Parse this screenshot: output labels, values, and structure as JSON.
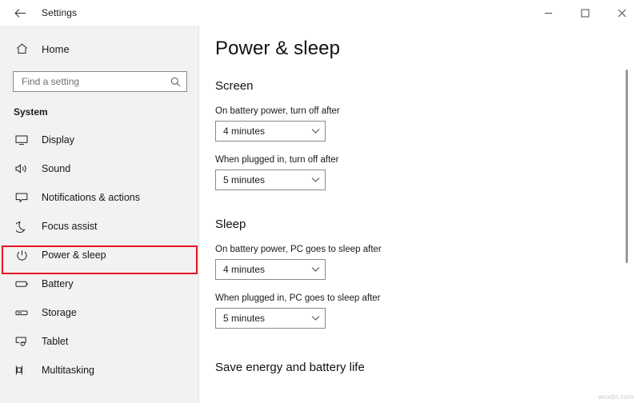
{
  "window": {
    "title": "Settings",
    "back_icon": "back-arrow-icon",
    "controls": {
      "minimize_label": "Minimize",
      "maximize_label": "Maximize",
      "close_label": "Close"
    }
  },
  "sidebar": {
    "home": {
      "label": "Home",
      "icon": "home-icon"
    },
    "search": {
      "placeholder": "Find a setting",
      "value": "",
      "icon": "search-icon"
    },
    "group_title": "System",
    "items": [
      {
        "label": "Display",
        "icon": "monitor-icon",
        "selected": false
      },
      {
        "label": "Sound",
        "icon": "speaker-icon",
        "selected": false
      },
      {
        "label": "Notifications & actions",
        "icon": "notification-icon",
        "selected": false
      },
      {
        "label": "Focus assist",
        "icon": "moon-icon",
        "selected": false
      },
      {
        "label": "Power & sleep",
        "icon": "power-icon",
        "selected": true
      },
      {
        "label": "Battery",
        "icon": "battery-icon",
        "selected": false
      },
      {
        "label": "Storage",
        "icon": "storage-icon",
        "selected": false
      },
      {
        "label": "Tablet",
        "icon": "tablet-icon",
        "selected": false
      },
      {
        "label": "Multitasking",
        "icon": "multitasking-icon",
        "selected": false
      }
    ]
  },
  "main": {
    "page_title": "Power & sleep",
    "sections": [
      {
        "heading": "Screen",
        "fields": [
          {
            "label": "On battery power, turn off after",
            "value": "4 minutes"
          },
          {
            "label": "When plugged in, turn off after",
            "value": "5 minutes"
          }
        ]
      },
      {
        "heading": "Sleep",
        "fields": [
          {
            "label": "On battery power, PC goes to sleep after",
            "value": "4 minutes"
          },
          {
            "label": "When plugged in, PC goes to sleep after",
            "value": "5 minutes"
          }
        ]
      },
      {
        "heading": "Save energy and battery life",
        "fields": []
      }
    ]
  },
  "annotation": {
    "color": "#e81123",
    "target": "Power & sleep"
  },
  "watermark": "wsxdn.com"
}
